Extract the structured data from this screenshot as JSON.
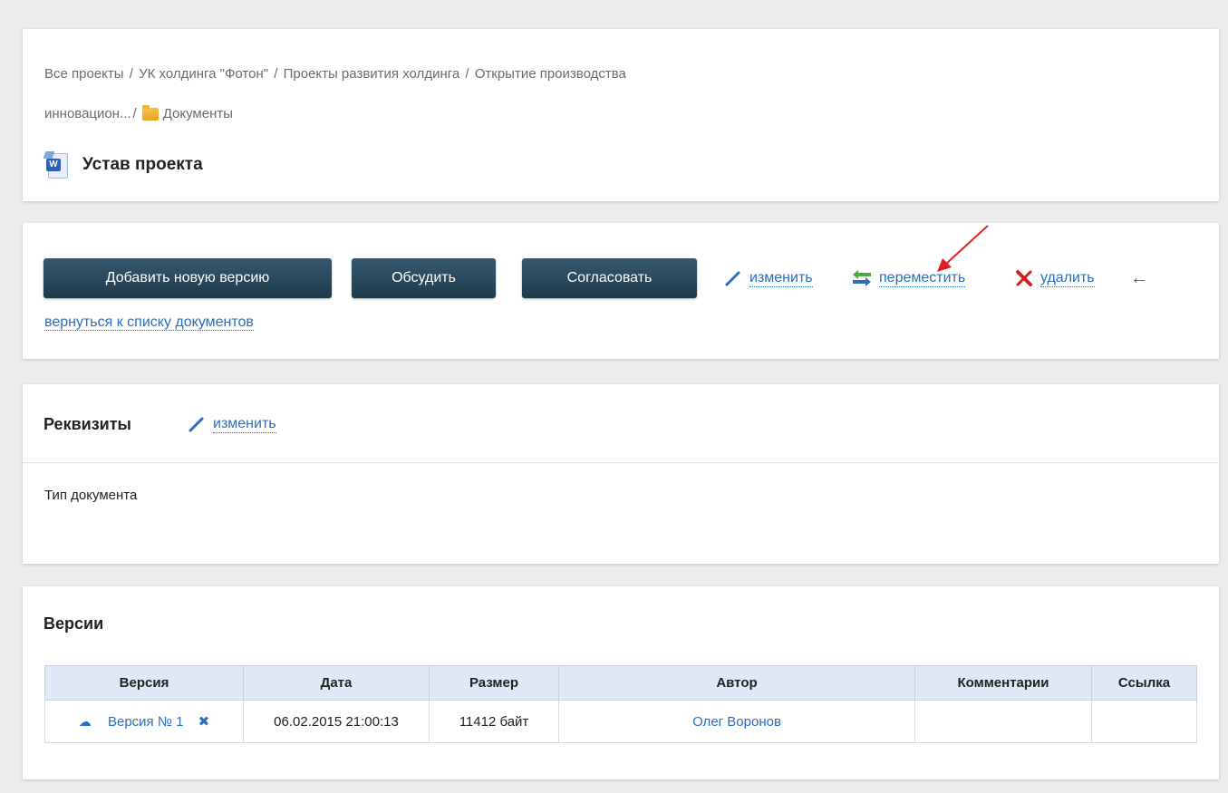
{
  "breadcrumb": {
    "items": [
      "Все проекты",
      "УК холдинга \"Фотон\"",
      "Проекты развития холдинга",
      "Открытие производства"
    ],
    "items_line2": [
      "инновацион...",
      "Документы"
    ],
    "separator": "/"
  },
  "document": {
    "title": "Устав проекта",
    "icon": "word-document-icon"
  },
  "actions": {
    "add_version": "Добавить новую версию",
    "discuss": "Обсудить",
    "approve": "Согласовать",
    "edit": "изменить",
    "move": "переместить",
    "delete": "удалить",
    "back_arrow": "←",
    "back": "вернуться к списку документов"
  },
  "properties": {
    "title": "Реквизиты",
    "edit": "изменить",
    "field_label": "Тип документа"
  },
  "versions": {
    "title": "Версии",
    "columns": [
      "Версия",
      "Дата",
      "Размер",
      "Автор",
      "Комментарии",
      "Ссылка"
    ],
    "rows": [
      {
        "version": "Версия № 1",
        "date": "06.02.2015 21:00:13",
        "size": "11412 байт",
        "author": "Олег Воронов",
        "comments": "",
        "link": ""
      }
    ]
  },
  "colors": {
    "link": "#2a6ebd",
    "button": "#2a4a5e",
    "annotation": "#e02020",
    "table_header": "#dfe8f4"
  }
}
